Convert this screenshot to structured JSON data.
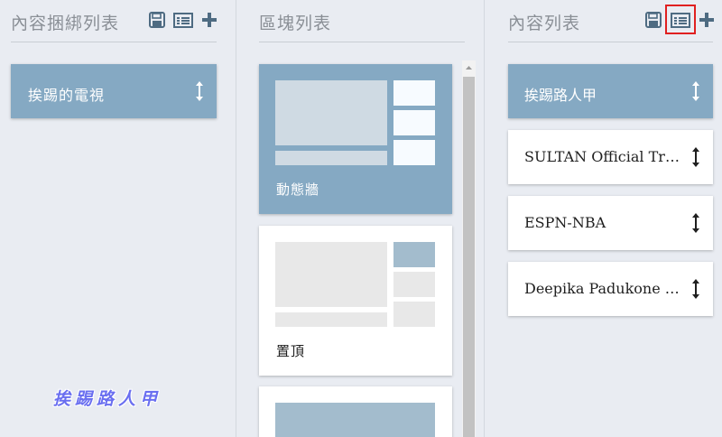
{
  "left_column": {
    "title": "內容捆綁列表",
    "icons": [
      "save-icon",
      "list-icon",
      "add-icon"
    ],
    "cards": [
      {
        "label": "挨踢的電視"
      }
    ]
  },
  "middle_column": {
    "title": "區塊列表",
    "blocks": [
      {
        "label": "動態牆",
        "selected": true
      },
      {
        "label": "置頂",
        "selected": false
      },
      {
        "label": "",
        "selected": false
      }
    ]
  },
  "right_column": {
    "title": "內容列表",
    "icons": [
      "save-icon",
      "list-icon",
      "add-icon"
    ],
    "highlighted_icon": "list-icon",
    "items": [
      {
        "label": "挨踢路人甲",
        "selected": true
      },
      {
        "label": "SULTAN Official Trail...",
        "selected": false
      },
      {
        "label": "ESPN-NBA",
        "selected": false
      },
      {
        "label": "Deepika Padukone H...",
        "selected": false
      }
    ]
  },
  "watermark": "挨踢路人甲",
  "colors": {
    "background": "#e9ecf2",
    "selected_card": "#85a9c3",
    "card": "#ffffff",
    "icon": "#4e6b82",
    "highlight": "#e02020"
  }
}
